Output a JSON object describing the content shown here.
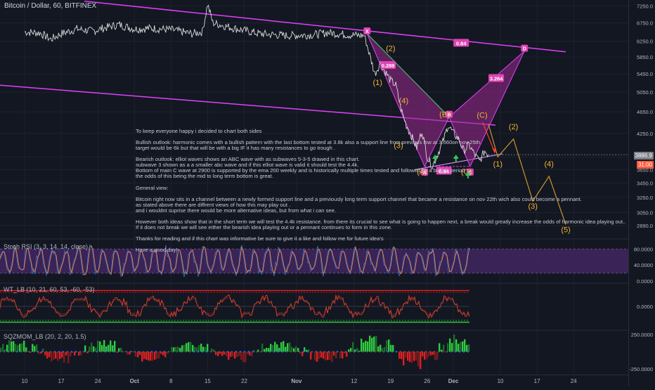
{
  "header": {
    "title": "Bitcoin / Dollar, 60, BITFINEX"
  },
  "indicators": {
    "stoch": "Stoch RSI (3, 3, 14, 14, close)",
    "wt": "WT_LB (10, 21, 60, 53, -60, -53)",
    "sqz": "SQZMOM_LB (20, 2, 20, 1.5)"
  },
  "price_tags": {
    "last": "3886.9",
    "countdown": "31:00"
  },
  "notes": [
    "To keep everyone happy i decided to chart both sides",
    "",
    "Bullish outlook: harmonic comes with a bullish pattern with the last bottom tested at 3.8k also a support line from previous low at 3.660on nov 25th.",
    "target would be 6k but that will be with a big IF it has many resistances to go trough .",
    "",
    "Bearish outlook: elliot waves shows an ABC wave with as subwaves 5-3-5 drawed in this chart.",
    "subwave 3 shown as a a smaller abc wave and if this elliot wave is valid it should test the 4.4k.",
    "Bottom of main C wave at 2900 is supported by the ema 200 weekly  and is historically multiple times tested and followed by a bullish period  .",
    "the odds of this being the mid to long term bottom is great.",
    "",
    "General view:",
    "",
    "Bitcoin right now sits in a  channel between a newly formed support line and a previously long term support channel that became a resistance on nov 22th wich also could become a pennant.",
    "as stated above there are diffrent views of how this may play out .",
    "and i wouldnt suprise there would be more alternative ideas, but from what i can see.",
    "",
    "However both ideas show that in the short term we will test the 4.4k resistance. from there its crucial to see what is going to happen next, a break would greatly increase the odds of harmonic idea playing out..",
    "If it does not break we will see either the bearish idea playing out or a pennant continues to form in this zone.",
    "",
    "Thanks for reading and if this chart was informative be sure to give it a like and follow me for future idea's",
    "",
    "Have a good day!"
  ],
  "chart_data": [
    {
      "type": "line",
      "title": "Bitcoin / Dollar, 60, BITFINEX",
      "y_scale": "log",
      "ylim": [
        2780,
        7350
      ],
      "y_ticks": [
        7250,
        6750,
        6250,
        5850,
        5450,
        5050,
        4650,
        4250,
        3850,
        3650,
        3450,
        3250,
        3050,
        2890
      ],
      "x_ticks": [
        "10",
        "17",
        "24",
        "Oct",
        "8",
        "15",
        "22",
        "Nov",
        "12",
        "19",
        "26",
        "Dec",
        "10",
        "17",
        "24"
      ],
      "x_tick_day_index": [
        0,
        7,
        14,
        21,
        28,
        35,
        42,
        52,
        63,
        70,
        77,
        82,
        91,
        98,
        105
      ],
      "price_path": [
        [
          0,
          6500
        ],
        [
          3,
          6470
        ],
        [
          5,
          6300
        ],
        [
          7,
          6450
        ],
        [
          10,
          6580
        ],
        [
          13,
          6520
        ],
        [
          15,
          6600
        ],
        [
          18,
          6700
        ],
        [
          21,
          6580
        ],
        [
          24,
          6600
        ],
        [
          28,
          6560
        ],
        [
          32,
          6450
        ],
        [
          34,
          6500
        ],
        [
          35,
          7300
        ],
        [
          36,
          6750
        ],
        [
          40,
          6600
        ],
        [
          45,
          6450
        ],
        [
          50,
          6400
        ],
        [
          55,
          6420
        ],
        [
          58,
          6480
        ],
        [
          62,
          6420
        ],
        [
          65,
          6400
        ],
        [
          66,
          5900
        ],
        [
          67,
          5450
        ],
        [
          68,
          5700
        ],
        [
          69,
          5500
        ],
        [
          70,
          5300
        ],
        [
          71,
          5200
        ],
        [
          72,
          4700
        ],
        [
          73,
          4400
        ],
        [
          74,
          4200
        ],
        [
          75,
          4000
        ],
        [
          76,
          4300
        ],
        [
          77,
          3850
        ],
        [
          78,
          3700
        ],
        [
          79,
          3900
        ],
        [
          80,
          4100
        ],
        [
          81,
          4400
        ],
        [
          82,
          4250
        ],
        [
          83,
          4150
        ],
        [
          84,
          3950
        ],
        [
          85,
          4050
        ],
        [
          86,
          3900
        ],
        [
          87,
          3780
        ],
        [
          88,
          3950
        ],
        [
          88.7,
          3887
        ]
      ],
      "harmonic": {
        "points": [
          {
            "label": "X",
            "day": 65.5,
            "price": 6450
          },
          {
            "label": "A",
            "day": 76.5,
            "price": 3700
          },
          {
            "label": "B",
            "day": 81.2,
            "price": 4550
          },
          {
            "label": "C",
            "day": 85.2,
            "price": 3700
          },
          {
            "label": "D",
            "day": 95.6,
            "price": 6000
          }
        ],
        "ratios": [
          "0.289",
          "0.84",
          "3.264",
          "0.84"
        ]
      },
      "elliott_labels": [
        {
          "label": "(1)",
          "day": 67.5,
          "price": 5200
        },
        {
          "label": "(2)",
          "day": 70,
          "price": 6000
        },
        {
          "label": "(3)",
          "day": 71.5,
          "price": 4000
        },
        {
          "label": "(4)",
          "day": 72.5,
          "price": 4820
        },
        {
          "label": "(A)",
          "day": 76,
          "price": 3580
        },
        {
          "label": "(B)",
          "day": 80.3,
          "price": 4550
        },
        {
          "label": "(C)",
          "day": 84.5,
          "price": 3580
        },
        {
          "label": "(C)",
          "day": 87.5,
          "price": 4540
        }
      ],
      "projection": {
        "path": [
          [
            88.7,
            4420
          ],
          [
            90.5,
            3850
          ],
          [
            93.5,
            4150
          ],
          [
            97.2,
            3200
          ],
          [
            100.3,
            3550
          ],
          [
            103.5,
            2900
          ]
        ],
        "labels": [
          {
            "label": "(1)",
            "day": 90.5,
            "price": 3700
          },
          {
            "label": "(2)",
            "day": 93.5,
            "price": 4320
          },
          {
            "label": "(3)",
            "day": 97.2,
            "price": 3100
          },
          {
            "label": "(4)",
            "day": 100.3,
            "price": 3700
          },
          {
            "label": "(5)",
            "day": 103.5,
            "price": 2810
          }
        ]
      }
    },
    {
      "type": "line",
      "title": "Stoch RSI (3, 3, 14, 14, close)",
      "series": [
        {
          "name": "K"
        },
        {
          "name": "D"
        }
      ],
      "ylim": [
        0,
        100
      ],
      "y_ticks": [
        80,
        40,
        0
      ],
      "y_tick_labels": [
        "80.0000",
        "40.0000",
        "0.0000"
      ],
      "band": [
        20,
        80
      ]
    },
    {
      "type": "line",
      "title": "WT_LB (10, 21, 60, 53, -60, -53)",
      "ylim": [
        -80,
        80
      ],
      "y_ticks": [
        0
      ],
      "y_tick_labels": [
        "0.0000"
      ],
      "levels": [
        60,
        53,
        -53,
        -60
      ]
    },
    {
      "type": "bar",
      "title": "SQZMOM_LB (20, 2, 20, 1.5)",
      "ylim": [
        -300,
        280
      ],
      "y_ticks": [
        250,
        -250
      ],
      "y_tick_labels": [
        "250.0000",
        "-250.0000"
      ]
    }
  ],
  "colors": {
    "bg": "#131722",
    "price": "#d8d8d8",
    "magenta": "#e040fb",
    "harmonic_fill": "#9c2a8e",
    "wave": "#f0b530",
    "green": "#34c759",
    "red": "#e01f1f",
    "stoch_k": "#2f7ad1",
    "stoch_d": "#ff8a3c",
    "stoch_band": "#4a2a6e",
    "wt_line": "#d8412c",
    "tag_last": "#9b9ba5",
    "tag_count": "#ff5a3c"
  }
}
